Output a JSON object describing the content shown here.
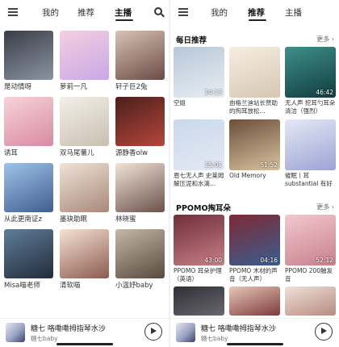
{
  "left": {
    "tabs": [
      "我的",
      "推荐",
      "主播"
    ],
    "active_tab": 2,
    "anchors": [
      {
        "name": "是动情呀",
        "colors": [
          "#3a3d46",
          "#8b93a3"
        ]
      },
      {
        "name": "萝莉一凡",
        "colors": [
          "#f4cfe0",
          "#c9a8e6"
        ]
      },
      {
        "name": "轩子巨2兔",
        "colors": [
          "#d8c2b5",
          "#6a4c46"
        ]
      },
      {
        "name": "诱耳",
        "colors": [
          "#f7d3da",
          "#d98aa2"
        ]
      },
      {
        "name": "双马尾薯儿",
        "colors": [
          "#f3efe8",
          "#c9bfb1"
        ]
      },
      {
        "name": "源静香olw",
        "colors": [
          "#4b1f1c",
          "#b6463a"
        ]
      },
      {
        "name": "从此更南证z",
        "colors": [
          "#9fc3ea",
          "#3f5e8e"
        ]
      },
      {
        "name": "墨玦助眠",
        "colors": [
          "#efe3d8",
          "#a88979"
        ]
      },
      {
        "name": "林晓蜜",
        "colors": [
          "#f1e4da",
          "#6b5149"
        ]
      },
      {
        "name": "Misa喵老师",
        "colors": [
          "#5f7d99",
          "#222c3a"
        ]
      },
      {
        "name": "清软喵",
        "colors": [
          "#f5e2d5",
          "#8c5b4e"
        ]
      },
      {
        "name": "小溫妤baby",
        "colors": [
          "#c5b8a8",
          "#57493d"
        ]
      }
    ]
  },
  "right": {
    "tabs": [
      "我的",
      "推荐",
      "主播"
    ],
    "active_tab": 1,
    "sections": [
      {
        "title": "每日推荐",
        "more": "更多",
        "items": [
          {
            "caption": "空姐",
            "duration": "14:13",
            "colors": [
              "#b7c7d8",
              "#e8eef3"
            ]
          },
          {
            "caption": "由格兰迪站长赞助的掏耳放松...",
            "duration": "",
            "colors": [
              "#f6eee2",
              "#d6c6b2"
            ]
          },
          {
            "caption": "无人声 挖耳勺耳朵清洁（强烈）",
            "duration": "46:42",
            "colors": [
              "#3f8f8a",
              "#0f3d3e"
            ]
          },
          {
            "caption": "恩七无人声 史莱姆解压泥和水滴...",
            "duration": "15:01",
            "colors": [
              "#c9d9ea",
              "#e4e9f4"
            ]
          },
          {
            "caption": "Old Memory",
            "duration": "51:52",
            "colors": [
              "#6a4e3a",
              "#d8c3a0"
            ]
          },
          {
            "caption": "催眠丨耳substantial 有好听的口腔音",
            "duration": "",
            "colors": [
              "#e5e8f6",
              "#9ba4d3"
            ]
          }
        ]
      },
      {
        "title": "PPOMO掏耳朵",
        "more": "更多",
        "items": [
          {
            "caption": "PPOMO 耳朵护理（英语）",
            "duration": "43:00",
            "colors": [
              "#6f2f3a",
              "#c77f86"
            ]
          },
          {
            "caption": "PPOMO 木材的声音（无人声）",
            "duration": "04:16",
            "colors": [
              "#7d2a33",
              "#3a5d92"
            ]
          },
          {
            "caption": "PPOMO 200触发音",
            "duration": "52:12",
            "colors": [
              "#f2c8cf",
              "#c9808c"
            ]
          }
        ]
      }
    ]
  },
  "player": {
    "title": "糖七 咯嘞嘞拇指琴水沙",
    "artist": "糖七baby"
  }
}
